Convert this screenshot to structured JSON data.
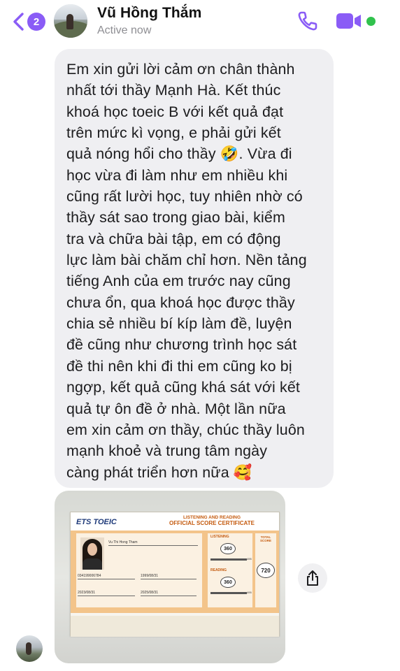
{
  "header": {
    "unread_count": "2",
    "contact_name": "Vũ Hồng Thắm",
    "status": "Active now"
  },
  "message": {
    "text": "Em xin gửi lời cảm ơn chân thành\nnhất tới thầy Mạnh Hà. Kết thúc\nkhoá học toeic B với kết quả đạt\ntrên mức kì vọng, e phải gửi kết\nquả nóng hổi cho thầy 🤣. Vừa đi\nhọc vừa đi làm như em nhiều khi\ncũng rất lười học, tuy nhiên nhờ có\nthầy sát sao trong giao bài, kiểm\ntra và chữa bài tập, em có động\nlực làm bài chăm chỉ hơn. Nền tảng\ntiếng Anh của em trước nay cũng\nchưa ổn, qua khoá học được thầy\nchia sẻ nhiều bí kíp làm đề, luyện\nđề cũng như chương trình học sát\nđề thi nên khi đi thi em cũng ko bị\nngợp, kết quả cũng khá sát với kết\nquả tự ôn đề ở nhà. Một lần nữa\nem xin cảm ơn thầy, chúc thầy luôn\nmạnh khoẻ và trung tâm ngày\ncàng phát triển hơn nữa 🥰"
  },
  "certificate": {
    "logo": "ETS TOEIC",
    "heading_top": "LISTENING AND READING",
    "heading_main": "OFFICIAL SCORE CERTIFICATE",
    "name": "Vu Thi Hong Tham",
    "id_number": "034199006784",
    "birth_date": "1999/08/31",
    "test_date": "2023/08/31",
    "valid_until": "2025/08/31",
    "listening_label": "LISTENING",
    "reading_label": "READING",
    "total_label": "TOTAL SCORE",
    "listening_score": "360",
    "reading_score": "360",
    "total_score": "720",
    "bar_max": "495"
  },
  "colors": {
    "accent": "#8a5cf6",
    "bubble": "#efeff2",
    "online": "#31c24d"
  },
  "icons": {
    "back": "chevron-left-icon",
    "call": "phone-icon",
    "video": "video-camera-icon",
    "share": "share-icon"
  }
}
